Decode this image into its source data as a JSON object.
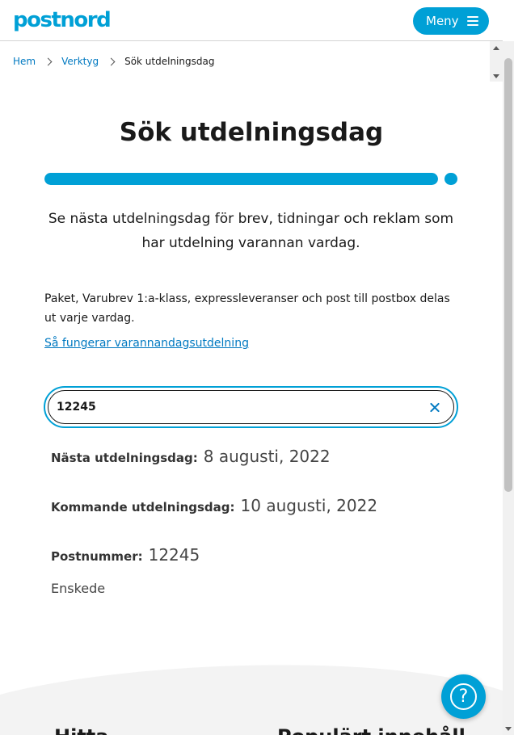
{
  "header": {
    "logo_text": "postnord",
    "menu_label": "Meny"
  },
  "breadcrumb": {
    "items": [
      "Hem",
      "Verktyg"
    ],
    "current": "Sök utdelningsdag"
  },
  "page": {
    "title": "Sök utdelningsdag",
    "progress": 1.0,
    "subtitle": "Se nästa utdelningsdag för brev, tidningar och reklam som har utdelning varannan vardag.",
    "info_text": "Paket, Varubrev 1:a-klass, expressleveranser och post till postbox delas ut varje vardag.",
    "info_link": "Så fungerar varannandagsutdelning"
  },
  "search": {
    "value": "12245",
    "placeholder": ""
  },
  "results": {
    "next_label": "Nästa utdelningsdag:",
    "next_value": "8 augusti, 2022",
    "upcoming_label": "Kommande utdelningsdag:",
    "upcoming_value": "10 augusti, 2022",
    "postcode_label": "Postnummer:",
    "postcode_value": "12245",
    "city": "Enskede"
  },
  "footer": {
    "heading_left": "Hitta",
    "heading_right": "Populärt innehåll"
  },
  "colors": {
    "brand": "#00a0d6",
    "link": "#0079c1",
    "footer_bg": "#f3f3f3"
  },
  "icons": {
    "menu": "hamburger-icon",
    "clear": "close-icon",
    "help": "help-icon",
    "breadcrumb_sep": "chevron-right-icon"
  }
}
